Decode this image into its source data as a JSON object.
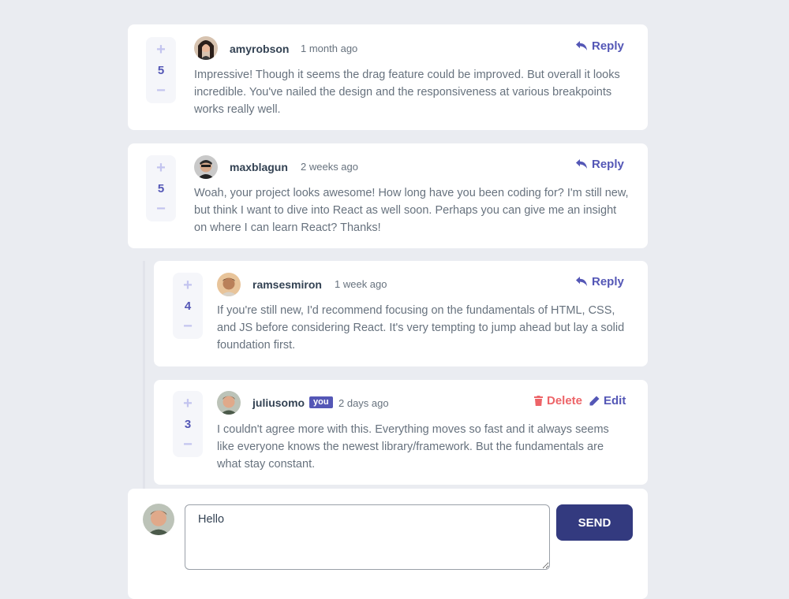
{
  "comments": [
    {
      "username": "amyrobson",
      "date": "1 month ago",
      "score": "5",
      "action": "Reply",
      "text": "Impressive! Though it seems the drag feature could be improved. But overall it looks incredible. You've nailed the design and the responsiveness at various breakpoints works really well."
    },
    {
      "username": "maxblagun",
      "date": "2 weeks ago",
      "score": "5",
      "action": "Reply",
      "text": "Woah, your project looks awesome! How long have you been coding for? I'm still new, but think I want to dive into React as well soon. Perhaps you can give me an insight on where I can learn React? Thanks!"
    }
  ],
  "replies": [
    {
      "username": "ramsesmiron",
      "date": "1 week ago",
      "score": "4",
      "action": "Reply",
      "text": "If you're still new, I'd recommend focusing on the fundamentals of HTML, CSS, and JS before considering React. It's very tempting to jump ahead but lay a solid foundation first."
    },
    {
      "username": "juliusomo",
      "badge": "you",
      "date": "2 days ago",
      "score": "3",
      "delete_label": "Delete",
      "edit_label": "Edit",
      "text": "I couldn't agree more with this. Everything moves so fast and it always seems like everyone knows the newest library/framework. But the fundamentals are what stay constant."
    }
  ],
  "composer": {
    "value": "Hello",
    "send_label": "SEND"
  },
  "icons": {
    "plus": "+",
    "minus": "−"
  },
  "colors": {
    "accent": "#5457b6",
    "danger": "#ed6468",
    "send_bg": "#333a7f"
  }
}
